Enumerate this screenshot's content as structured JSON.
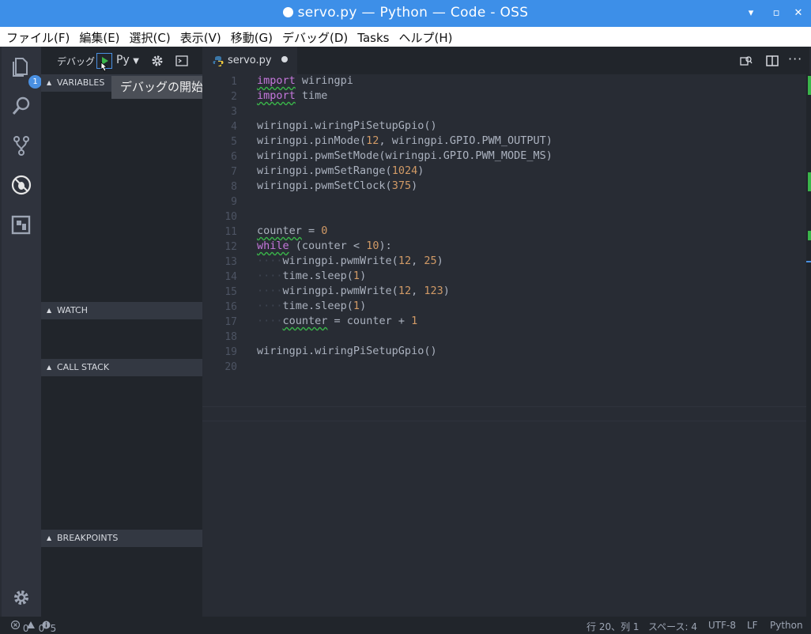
{
  "window": {
    "title": "servo.py — Python — Code - OSS",
    "minimize": "▾",
    "maximize": "▫",
    "close": "✕"
  },
  "menu": [
    "ファイル(F)",
    "編集(E)",
    "選択(C)",
    "表示(V)",
    "移動(G)",
    "デバッグ(D)",
    "Tasks",
    "ヘルプ(H)"
  ],
  "activity": {
    "explorer_badge": "1"
  },
  "debug": {
    "label": "デバッグ",
    "config": "Py",
    "tooltip": "デバッグの開始"
  },
  "sections": {
    "variables": "VARIABLES",
    "watch": "WATCH",
    "callstack": "CALL STACK",
    "breakpoints": "BREAKPOINTS"
  },
  "tab": {
    "name": "servo.py"
  },
  "lines": [
    "1",
    "2",
    "3",
    "4",
    "5",
    "6",
    "7",
    "8",
    "9",
    "10",
    "11",
    "12",
    "13",
    "14",
    "15",
    "16",
    "17",
    "18",
    "19",
    "20"
  ],
  "code": {
    "l1a": "import",
    "l1b": " wiringpi",
    "l2a": "import",
    "l2b": " time",
    "l4": "wiringpi.wiringPiSetupGpio()",
    "l5a": "wiringpi.pinMode(",
    "l5b": "12",
    "l5c": ", wiringpi.GPIO.PWM_OUTPUT)",
    "l6": "wiringpi.pwmSetMode(wiringpi.GPIO.PWM_MODE_MS)",
    "l7a": "wiringpi.pwmSetRange(",
    "l7b": "1024",
    "l7c": ")",
    "l8a": "wiringpi.pwmSetClock(",
    "l8b": "375",
    "l8c": ")",
    "l11a": "counter",
    "l11b": " = ",
    "l11c": "0",
    "l12a": "while",
    "l12b": " (counter < ",
    "l12c": "10",
    "l12d": "):",
    "ind": "····",
    "l13a": "wiringpi.pwmWrite(",
    "l13b": "12",
    "l13c": ", ",
    "l13d": "25",
    "l13e": ")",
    "l14a": "time.sleep(",
    "l14b": "1",
    "l14c": ")",
    "l15a": "wiringpi.pwmWrite(",
    "l15b": "12",
    "l15c": ", ",
    "l15d": "123",
    "l15e": ")",
    "l16a": "time.sleep(",
    "l16b": "1",
    "l16c": ")",
    "l17a": "counter",
    "l17b": " = counter + ",
    "l17c": "1",
    "l19": "wiringpi.wiringPiSetupGpio()"
  },
  "status": {
    "errors": "0",
    "warnings": "0",
    "infos": "5",
    "position": "行 20、列 1",
    "spaces": "スペース: 4",
    "encoding": "UTF-8",
    "eol": "LF",
    "language": "Python"
  },
  "colors": {
    "titlebar": "#3d8fe8",
    "keyword": "#c678dd",
    "number": "#d19a66",
    "squiggle": "#3ab54a"
  }
}
